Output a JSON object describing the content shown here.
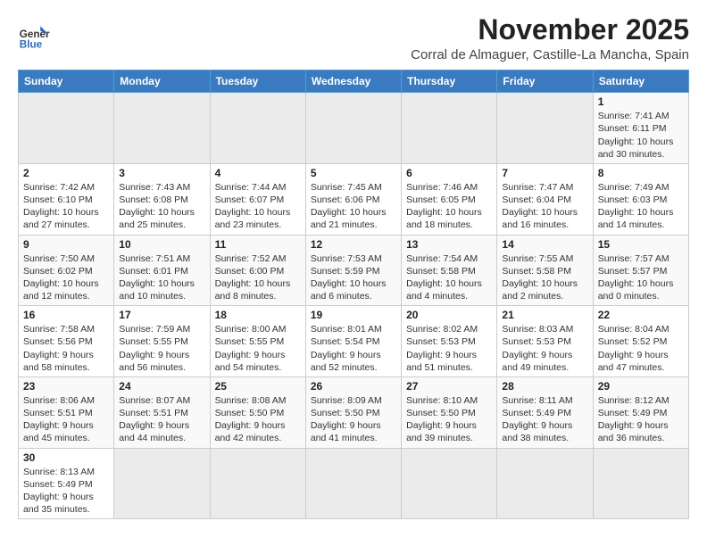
{
  "header": {
    "logo_general": "General",
    "logo_blue": "Blue",
    "month": "November 2025",
    "location": "Corral de Almaguer, Castille-La Mancha, Spain"
  },
  "weekdays": [
    "Sunday",
    "Monday",
    "Tuesday",
    "Wednesday",
    "Thursday",
    "Friday",
    "Saturday"
  ],
  "weeks": [
    [
      {
        "day": "",
        "info": "",
        "empty": true
      },
      {
        "day": "",
        "info": "",
        "empty": true
      },
      {
        "day": "",
        "info": "",
        "empty": true
      },
      {
        "day": "",
        "info": "",
        "empty": true
      },
      {
        "day": "",
        "info": "",
        "empty": true
      },
      {
        "day": "",
        "info": "",
        "empty": true
      },
      {
        "day": "1",
        "info": "Sunrise: 7:41 AM\nSunset: 6:11 PM\nDaylight: 10 hours\nand 30 minutes."
      }
    ],
    [
      {
        "day": "2",
        "info": "Sunrise: 7:42 AM\nSunset: 6:10 PM\nDaylight: 10 hours\nand 27 minutes."
      },
      {
        "day": "3",
        "info": "Sunrise: 7:43 AM\nSunset: 6:08 PM\nDaylight: 10 hours\nand 25 minutes."
      },
      {
        "day": "4",
        "info": "Sunrise: 7:44 AM\nSunset: 6:07 PM\nDaylight: 10 hours\nand 23 minutes."
      },
      {
        "day": "5",
        "info": "Sunrise: 7:45 AM\nSunset: 6:06 PM\nDaylight: 10 hours\nand 21 minutes."
      },
      {
        "day": "6",
        "info": "Sunrise: 7:46 AM\nSunset: 6:05 PM\nDaylight: 10 hours\nand 18 minutes."
      },
      {
        "day": "7",
        "info": "Sunrise: 7:47 AM\nSunset: 6:04 PM\nDaylight: 10 hours\nand 16 minutes."
      },
      {
        "day": "8",
        "info": "Sunrise: 7:49 AM\nSunset: 6:03 PM\nDaylight: 10 hours\nand 14 minutes."
      }
    ],
    [
      {
        "day": "9",
        "info": "Sunrise: 7:50 AM\nSunset: 6:02 PM\nDaylight: 10 hours\nand 12 minutes."
      },
      {
        "day": "10",
        "info": "Sunrise: 7:51 AM\nSunset: 6:01 PM\nDaylight: 10 hours\nand 10 minutes."
      },
      {
        "day": "11",
        "info": "Sunrise: 7:52 AM\nSunset: 6:00 PM\nDaylight: 10 hours\nand 8 minutes."
      },
      {
        "day": "12",
        "info": "Sunrise: 7:53 AM\nSunset: 5:59 PM\nDaylight: 10 hours\nand 6 minutes."
      },
      {
        "day": "13",
        "info": "Sunrise: 7:54 AM\nSunset: 5:58 PM\nDaylight: 10 hours\nand 4 minutes."
      },
      {
        "day": "14",
        "info": "Sunrise: 7:55 AM\nSunset: 5:58 PM\nDaylight: 10 hours\nand 2 minutes."
      },
      {
        "day": "15",
        "info": "Sunrise: 7:57 AM\nSunset: 5:57 PM\nDaylight: 10 hours\nand 0 minutes."
      }
    ],
    [
      {
        "day": "16",
        "info": "Sunrise: 7:58 AM\nSunset: 5:56 PM\nDaylight: 9 hours\nand 58 minutes."
      },
      {
        "day": "17",
        "info": "Sunrise: 7:59 AM\nSunset: 5:55 PM\nDaylight: 9 hours\nand 56 minutes."
      },
      {
        "day": "18",
        "info": "Sunrise: 8:00 AM\nSunset: 5:55 PM\nDaylight: 9 hours\nand 54 minutes."
      },
      {
        "day": "19",
        "info": "Sunrise: 8:01 AM\nSunset: 5:54 PM\nDaylight: 9 hours\nand 52 minutes."
      },
      {
        "day": "20",
        "info": "Sunrise: 8:02 AM\nSunset: 5:53 PM\nDaylight: 9 hours\nand 51 minutes."
      },
      {
        "day": "21",
        "info": "Sunrise: 8:03 AM\nSunset: 5:53 PM\nDaylight: 9 hours\nand 49 minutes."
      },
      {
        "day": "22",
        "info": "Sunrise: 8:04 AM\nSunset: 5:52 PM\nDaylight: 9 hours\nand 47 minutes."
      }
    ],
    [
      {
        "day": "23",
        "info": "Sunrise: 8:06 AM\nSunset: 5:51 PM\nDaylight: 9 hours\nand 45 minutes."
      },
      {
        "day": "24",
        "info": "Sunrise: 8:07 AM\nSunset: 5:51 PM\nDaylight: 9 hours\nand 44 minutes."
      },
      {
        "day": "25",
        "info": "Sunrise: 8:08 AM\nSunset: 5:50 PM\nDaylight: 9 hours\nand 42 minutes."
      },
      {
        "day": "26",
        "info": "Sunrise: 8:09 AM\nSunset: 5:50 PM\nDaylight: 9 hours\nand 41 minutes."
      },
      {
        "day": "27",
        "info": "Sunrise: 8:10 AM\nSunset: 5:50 PM\nDaylight: 9 hours\nand 39 minutes."
      },
      {
        "day": "28",
        "info": "Sunrise: 8:11 AM\nSunset: 5:49 PM\nDaylight: 9 hours\nand 38 minutes."
      },
      {
        "day": "29",
        "info": "Sunrise: 8:12 AM\nSunset: 5:49 PM\nDaylight: 9 hours\nand 36 minutes."
      }
    ],
    [
      {
        "day": "30",
        "info": "Sunrise: 8:13 AM\nSunset: 5:49 PM\nDaylight: 9 hours\nand 35 minutes."
      },
      {
        "day": "",
        "info": "",
        "empty": true
      },
      {
        "day": "",
        "info": "",
        "empty": true
      },
      {
        "day": "",
        "info": "",
        "empty": true
      },
      {
        "day": "",
        "info": "",
        "empty": true
      },
      {
        "day": "",
        "info": "",
        "empty": true
      },
      {
        "day": "",
        "info": "",
        "empty": true
      }
    ]
  ]
}
